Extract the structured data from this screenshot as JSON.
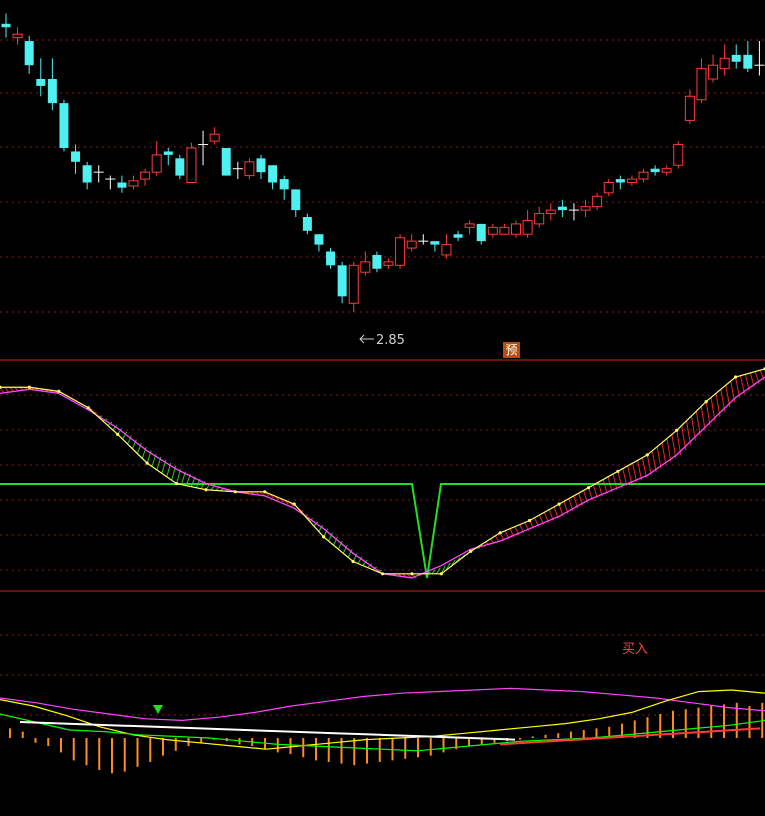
{
  "chart_data": [
    {
      "type": "candlestick",
      "ylim": [
        2.6,
        4.6
      ],
      "grid": true,
      "annotations": {
        "low_label": "2.85",
        "forecast_badge": "预"
      },
      "candles": [
        [
          4.52,
          4.5,
          4.58,
          4.44
        ],
        [
          4.44,
          4.46,
          4.5,
          4.4
        ],
        [
          4.42,
          4.28,
          4.45,
          4.23
        ],
        [
          4.2,
          4.16,
          4.32,
          4.1
        ],
        [
          4.2,
          4.06,
          4.32,
          4.02
        ],
        [
          4.06,
          3.8,
          4.08,
          3.78
        ],
        [
          3.78,
          3.72,
          3.82,
          3.65
        ],
        [
          3.7,
          3.6,
          3.72,
          3.56
        ],
        [
          3.66,
          3.66,
          3.7,
          3.6
        ],
        [
          3.62,
          3.62,
          3.64,
          3.56
        ],
        [
          3.6,
          3.57,
          3.64,
          3.54
        ],
        [
          3.58,
          3.61,
          3.64,
          3.56
        ],
        [
          3.62,
          3.66,
          3.68,
          3.58
        ],
        [
          3.66,
          3.76,
          3.84,
          3.64
        ],
        [
          3.78,
          3.76,
          3.8,
          3.7
        ],
        [
          3.74,
          3.64,
          3.76,
          3.62
        ],
        [
          3.6,
          3.8,
          3.83,
          3.6
        ],
        [
          3.82,
          3.82,
          3.9,
          3.7
        ],
        [
          3.84,
          3.88,
          3.92,
          3.82
        ],
        [
          3.8,
          3.64,
          3.8,
          3.64
        ],
        [
          3.68,
          3.68,
          3.72,
          3.62
        ],
        [
          3.64,
          3.72,
          3.74,
          3.62
        ],
        [
          3.74,
          3.66,
          3.76,
          3.62
        ],
        [
          3.7,
          3.6,
          3.7,
          3.56
        ],
        [
          3.62,
          3.56,
          3.64,
          3.5
        ],
        [
          3.56,
          3.44,
          3.56,
          3.4
        ],
        [
          3.4,
          3.32,
          3.42,
          3.3
        ],
        [
          3.3,
          3.24,
          3.3,
          3.2
        ],
        [
          3.2,
          3.12,
          3.22,
          3.1
        ],
        [
          3.12,
          2.94,
          3.14,
          2.9
        ],
        [
          2.9,
          3.12,
          3.14,
          2.85
        ],
        [
          3.08,
          3.14,
          3.2,
          3.06
        ],
        [
          3.18,
          3.1,
          3.2,
          3.08
        ],
        [
          3.12,
          3.14,
          3.16,
          3.1
        ],
        [
          3.12,
          3.28,
          3.3,
          3.1
        ],
        [
          3.22,
          3.26,
          3.3,
          3.2
        ],
        [
          3.26,
          3.26,
          3.3,
          3.24
        ],
        [
          3.26,
          3.24,
          3.26,
          3.2
        ],
        [
          3.18,
          3.24,
          3.3,
          3.16
        ],
        [
          3.3,
          3.28,
          3.32,
          3.26
        ],
        [
          3.34,
          3.36,
          3.38,
          3.3
        ],
        [
          3.36,
          3.26,
          3.36,
          3.24
        ],
        [
          3.3,
          3.34,
          3.36,
          3.28
        ],
        [
          3.3,
          3.34,
          3.36,
          3.3
        ],
        [
          3.3,
          3.36,
          3.38,
          3.28
        ],
        [
          3.3,
          3.38,
          3.44,
          3.28
        ],
        [
          3.36,
          3.42,
          3.46,
          3.34
        ],
        [
          3.42,
          3.44,
          3.48,
          3.38
        ],
        [
          3.46,
          3.44,
          3.5,
          3.4
        ],
        [
          3.44,
          3.44,
          3.48,
          3.38
        ],
        [
          3.44,
          3.46,
          3.5,
          3.4
        ],
        [
          3.46,
          3.52,
          3.54,
          3.44
        ],
        [
          3.54,
          3.6,
          3.62,
          3.52
        ],
        [
          3.62,
          3.6,
          3.64,
          3.56
        ],
        [
          3.6,
          3.62,
          3.64,
          3.58
        ],
        [
          3.62,
          3.66,
          3.68,
          3.6
        ],
        [
          3.68,
          3.66,
          3.7,
          3.64
        ],
        [
          3.66,
          3.68,
          3.7,
          3.64
        ],
        [
          3.7,
          3.82,
          3.84,
          3.68
        ],
        [
          3.96,
          4.1,
          4.14,
          3.94
        ],
        [
          4.08,
          4.26,
          4.32,
          4.06
        ],
        [
          4.2,
          4.28,
          4.34,
          4.18
        ],
        [
          4.26,
          4.32,
          4.4,
          4.22
        ],
        [
          4.34,
          4.3,
          4.4,
          4.26
        ],
        [
          4.34,
          4.26,
          4.42,
          4.24
        ],
        [
          4.28,
          4.28,
          4.42,
          4.22
        ]
      ]
    },
    {
      "type": "line",
      "ylim": [
        0,
        100
      ],
      "series": [
        {
          "color": "#ffff44",
          "style": "dotted",
          "values": [
            95,
            95,
            93,
            85,
            72,
            58,
            48,
            45,
            44,
            44,
            38,
            22,
            10,
            4,
            4,
            4,
            15,
            24,
            30,
            38,
            46,
            54,
            62,
            74,
            88,
            100,
            104
          ]
        },
        {
          "color": "#ff44ff",
          "values": [
            92,
            94,
            92,
            84,
            75,
            64,
            55,
            48,
            44,
            42,
            36,
            26,
            14,
            4,
            2,
            8,
            16,
            20,
            26,
            32,
            40,
            46,
            52,
            62,
            76,
            90,
            100
          ]
        },
        {
          "color": "#00ff00",
          "values": [
            90,
            92,
            90,
            82,
            74,
            62,
            52,
            48,
            44,
            42,
            38,
            28,
            16,
            6,
            4,
            60,
            60,
            60,
            60,
            60,
            60,
            60,
            60,
            60,
            60,
            60,
            60
          ]
        }
      ]
    },
    {
      "type": "bar+line",
      "ylim": [
        -100,
        60
      ],
      "annotations": {
        "signal_text": "买入"
      },
      "histogram": [
        12,
        8,
        -6,
        -10,
        -18,
        -28,
        -34,
        -40,
        -44,
        -42,
        -36,
        -30,
        -22,
        -16,
        -10,
        -6,
        -2,
        -4,
        -8,
        -10,
        -14,
        -18,
        -20,
        -24,
        -28,
        -30,
        -32,
        -34,
        -32,
        -30,
        -28,
        -26,
        -24,
        -22,
        -18,
        -14,
        -10,
        -8,
        -6,
        -4,
        -2,
        2,
        4,
        6,
        8,
        10,
        12,
        14,
        18,
        22,
        26,
        30,
        34,
        36,
        38,
        40,
        42,
        44,
        40,
        44
      ],
      "series": [
        {
          "color": "#ff44ff",
          "values": [
            50,
            44,
            36,
            30,
            24,
            22,
            26,
            32,
            40,
            46,
            52,
            56,
            58,
            60,
            62,
            60,
            58,
            54,
            50,
            44,
            38,
            34
          ]
        },
        {
          "color": "#ffff00",
          "values": [
            48,
            40,
            28,
            14,
            4,
            -2,
            -6,
            -10,
            -14,
            -10,
            -6,
            -2,
            0,
            2,
            6,
            10,
            14,
            18,
            24,
            32,
            46,
            58,
            60,
            56
          ]
        },
        {
          "color": "#00ff00",
          "values": [
            30,
            20,
            10,
            8,
            4,
            2,
            0,
            -4,
            -8,
            -10,
            -12,
            -14,
            -16,
            -12,
            -8,
            -4,
            -2,
            0,
            4,
            8,
            12,
            16,
            22
          ]
        },
        {
          "color": "#ffffff",
          "values": [
            20,
            18,
            16,
            14,
            12,
            10,
            8,
            6,
            4,
            2,
            0,
            -2
          ]
        },
        {
          "color": "#ff3a3a",
          "values": [
            -8,
            -6,
            -4,
            -2,
            0,
            2,
            4,
            6,
            8,
            10,
            12
          ]
        }
      ]
    }
  ]
}
